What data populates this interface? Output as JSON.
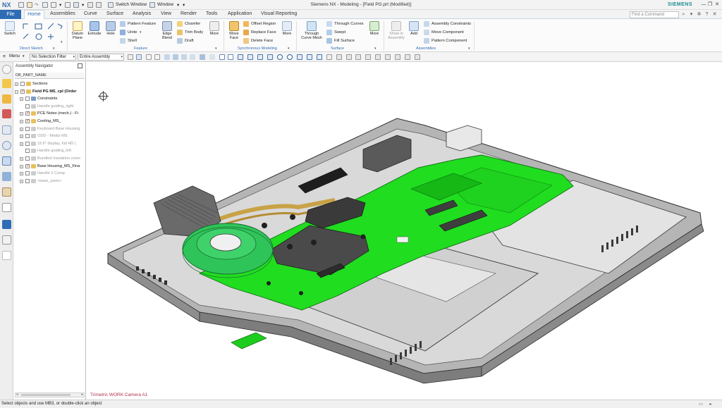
{
  "window": {
    "logo": "NX",
    "title": "Siemens NX - Modeling - [Field PG.prt (Modified)]",
    "brand": "SIEMENS",
    "switch_window_label": "Switch Window",
    "window_menu_label": "Window"
  },
  "tabs": {
    "file": "File",
    "items": [
      "Home",
      "Assemblies",
      "Curve",
      "Surface",
      "Analysis",
      "View",
      "Render",
      "Tools",
      "Application",
      "Visual Reporting"
    ],
    "active": "Home",
    "find_placeholder": "Find a Command"
  },
  "ribbon": {
    "direct_sketch": {
      "switch_label": "Switch",
      "group_label": "Direct Sketch"
    },
    "feature": {
      "datum_plane": "Datum Plane",
      "extrude": "Extrude",
      "hole": "Hole",
      "pattern_feature": "Pattern Feature",
      "unite": "Unite",
      "shell": "Shell",
      "edge_blend": "Edge Blend",
      "chamfer": "Chamfer",
      "trim_body": "Trim Body",
      "draft": "Draft",
      "more": "More",
      "group_label": "Feature"
    },
    "synchronous": {
      "move_face": "Move Face",
      "offset_region": "Offset Region",
      "replace_face": "Replace Face",
      "delete_face": "Delete Face",
      "more": "More",
      "group_label": "Synchronous Modeling"
    },
    "surface": {
      "through_curve_mesh": "Through Curve Mesh",
      "through_curves": "Through Curves",
      "swept": "Swept",
      "fill_surface": "Fill Surface",
      "more": "More",
      "group_label": "Surface"
    },
    "assemblies": {
      "show_in_assembly": "Show in Assembly",
      "add": "Add",
      "assembly_constraints": "Assembly Constraints",
      "move_component": "Move Component",
      "pattern_component": "Pattern Component",
      "group_label": "Assemblies"
    }
  },
  "selection_bar": {
    "menu_label": "Menu",
    "filter": "No Selection Filter",
    "scope": "Entire Assembly"
  },
  "navigator": {
    "title": "Assembly Navigator",
    "column_header": "DB_PART_NAME",
    "rows": [
      {
        "label": "Sections",
        "indent": 1,
        "checked": false,
        "color": "#e8c15a",
        "dim": false,
        "expander": "+"
      },
      {
        "label": "Field PG MS_cpl (Order",
        "indent": 1,
        "checked": true,
        "color": "#e8c15a",
        "dim": false,
        "expander": "−",
        "bold": true
      },
      {
        "label": "Constraints",
        "indent": 2,
        "checked": false,
        "color": "#7a9cc9",
        "dim": false,
        "expander": "+"
      },
      {
        "label": "Handle guiding_right",
        "indent": 2,
        "checked": false,
        "color": "#cccccc",
        "dim": true,
        "expander": ""
      },
      {
        "label": "PCE Notes (mech.) - Fi",
        "indent": 2,
        "checked": true,
        "color": "#e8c15a",
        "dim": false,
        "expander": "+"
      },
      {
        "label": "Cooling_MS_",
        "indent": 2,
        "checked": true,
        "color": "#e8c15a",
        "dim": false,
        "expander": "+"
      },
      {
        "label": "Keyboard Base Housing",
        "indent": 2,
        "checked": false,
        "color": "#cccccc",
        "dim": true,
        "expander": "+"
      },
      {
        "label": "ODD - Modul MS",
        "indent": 2,
        "checked": false,
        "color": "#cccccc",
        "dim": true,
        "expander": "+"
      },
      {
        "label": "15.6\" display, full HD (",
        "indent": 2,
        "checked": false,
        "color": "#cccccc",
        "dim": true,
        "expander": "+"
      },
      {
        "label": "Handle guiding_left",
        "indent": 2,
        "checked": false,
        "color": "#cccccc",
        "dim": true,
        "expander": ""
      },
      {
        "label": "Bundled Insulation cover",
        "indent": 2,
        "checked": false,
        "color": "#cccccc",
        "dim": true,
        "expander": "+"
      },
      {
        "label": "Base Housing_MS_Fina",
        "indent": 2,
        "checked": true,
        "color": "#e8c15a",
        "dim": false,
        "expander": "+"
      },
      {
        "label": "Handle 2 Comp.",
        "indent": 2,
        "checked": false,
        "color": "#cccccc",
        "dim": true,
        "expander": "+"
      },
      {
        "label": "<base_parts>",
        "indent": 2,
        "checked": false,
        "color": "#cccccc",
        "dim": true,
        "expander": "+"
      }
    ]
  },
  "graphics": {
    "view_label": "Trimetric WORK Camera A1"
  },
  "status": {
    "message": "Select objects and use MB3, or double-click an object"
  },
  "colors": {
    "accent": "#2e6cb5",
    "pcb_green": "#20dd20",
    "housing_grey": "#a9a9a9",
    "view_label": "#b0304a"
  }
}
